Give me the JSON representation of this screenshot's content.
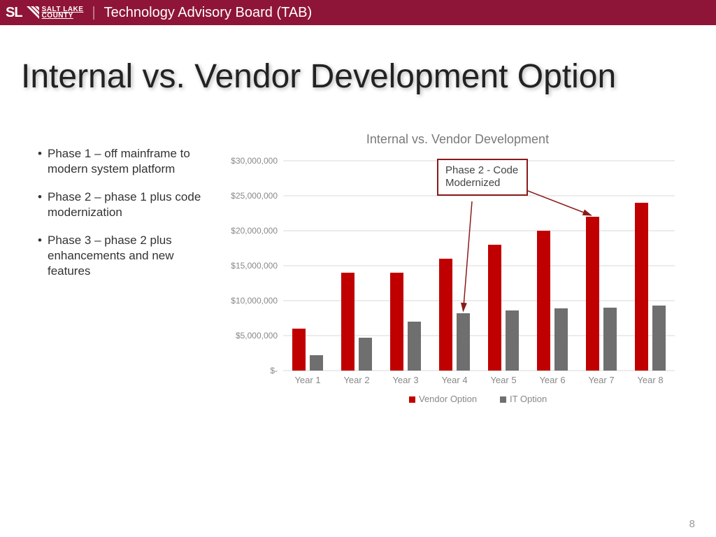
{
  "header": {
    "logo_sl": "SL",
    "logo_l1": "SALT LAKE",
    "logo_l2": "COUNTY",
    "title": "Technology Advisory Board (TAB)"
  },
  "slide_title": "Internal vs. Vendor Development Option",
  "bullets": [
    "Phase 1 – off mainframe to modern system platform",
    "Phase 2 – phase 1 plus code modernization",
    "Phase 3 – phase 2 plus enhancements and new features"
  ],
  "annotation": "Phase 2 - Code Modernized",
  "page_number": "8",
  "chart_data": {
    "type": "bar",
    "title": "Internal vs. Vendor Development",
    "categories": [
      "Year 1",
      "Year 2",
      "Year 3",
      "Year 4",
      "Year 5",
      "Year 6",
      "Year 7",
      "Year 8"
    ],
    "series": [
      {
        "name": "Vendor Option",
        "color": "#c00000",
        "values": [
          6000000,
          14000000,
          14000000,
          16000000,
          18000000,
          20000000,
          22000000,
          24000000
        ]
      },
      {
        "name": "IT Option",
        "color": "#6f6f6f",
        "values": [
          2200000,
          4700000,
          7000000,
          8200000,
          8600000,
          8900000,
          9000000,
          9300000
        ]
      }
    ],
    "ylabel": "",
    "xlabel": "",
    "ylim": [
      0,
      30000000
    ],
    "y_ticks": [
      0,
      5000000,
      10000000,
      15000000,
      20000000,
      25000000,
      30000000
    ],
    "y_tick_labels": [
      "$-",
      "$5,000,000",
      "$10,000,000",
      "$15,000,000",
      "$20,000,000",
      "$25,000,000",
      "$30,000,000"
    ]
  }
}
